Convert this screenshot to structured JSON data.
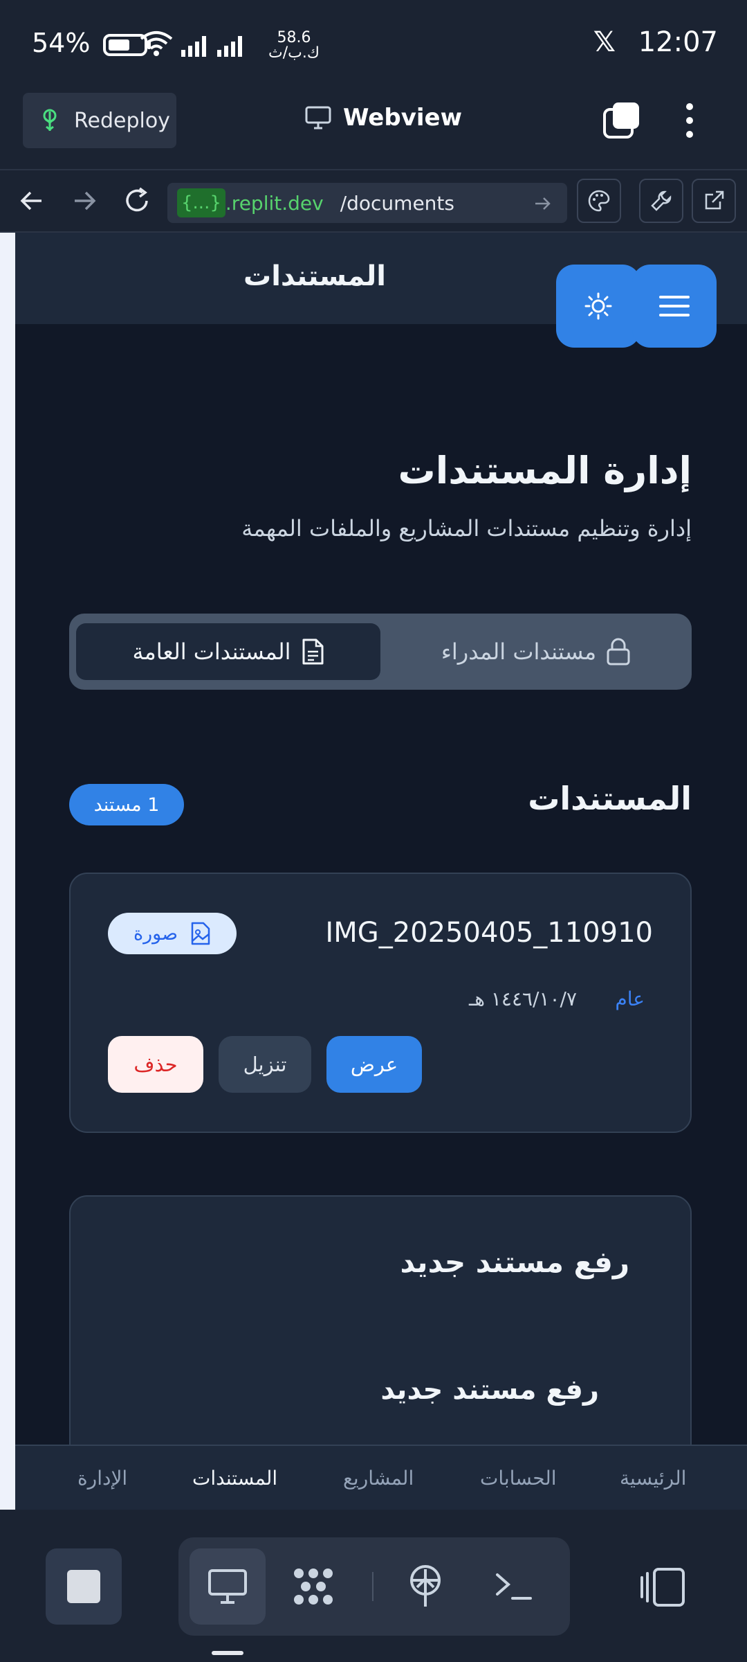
{
  "status_bar": {
    "battery": "54%",
    "net_speed_value": "58.6",
    "net_speed_unit": "ك.ب/ث",
    "time": "12:07",
    "notification_icon": "x-icon"
  },
  "toolbar": {
    "redeploy_label": "Redeploy",
    "webview_label": "Webview"
  },
  "url_bar": {
    "braces": "{...}",
    "host": ".replit.dev",
    "path": "/documents"
  },
  "app_header": {
    "title": "المستندات"
  },
  "page": {
    "title": "إدارة المستندات",
    "subtitle": "إدارة وتنظيم مستندات المشاريع والملفات المهمة"
  },
  "tabs": {
    "public": "المستندات العامة",
    "managers": "مستندات المدراء"
  },
  "documents_section": {
    "title": "المستندات",
    "count": "1 مستند"
  },
  "document": {
    "name": "IMG_20250405_110910",
    "type": "صورة",
    "category": "عام",
    "date": "١٤٤٦/١٠/٧ هـ",
    "view": "عرض",
    "download": "تنزيل",
    "delete": "حذف"
  },
  "upload": {
    "card_title": "رفع مستند جديد",
    "form_title": "رفع مستند جديد"
  },
  "app_nav": {
    "home": "الرئيسية",
    "accounts": "الحسابات",
    "projects": "المشاريع",
    "documents": "المستندات",
    "admin": "الإدارة"
  },
  "colors": {
    "accent": "#3182e6",
    "background": "#111827",
    "card": "#1e293b",
    "danger": "#dc2626"
  }
}
